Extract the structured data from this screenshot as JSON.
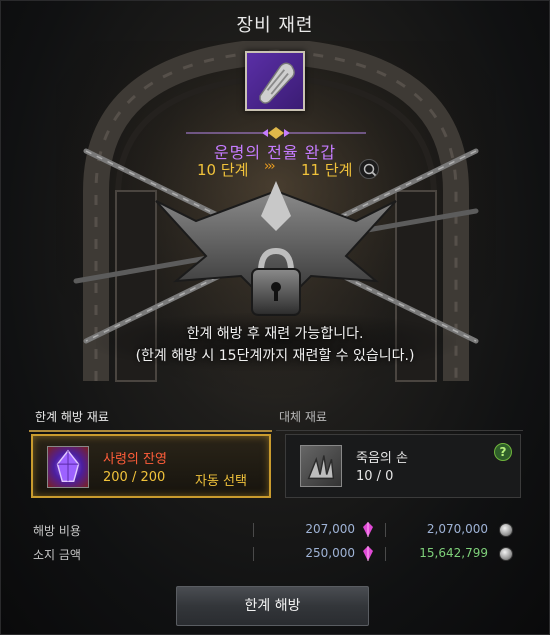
{
  "window": {
    "title": "장비 재련"
  },
  "item": {
    "icon": "gauntlet-icon",
    "name": "운명의 전율 완갑",
    "grade_from": "10 단계",
    "grade_arrows": "›››",
    "grade_to": "11 단계",
    "magnify_icon": "magnify-icon"
  },
  "notice": {
    "line1": "한계 해방 후 재련 가능합니다.",
    "line2": "(한계 해방 시 15단계까지 재련할 수 있습니다.)"
  },
  "materials": {
    "left_label": "한계 해방 재료",
    "right_label": "대체 재료",
    "primary": {
      "icon": "spirit-crystal-icon",
      "name": "사령의 잔영",
      "count": "200 / 200",
      "auto_select": "자동 선택"
    },
    "alternate": {
      "icon": "death-claw-icon",
      "name": "죽음의 손",
      "count": "10 / 0",
      "help": "?"
    }
  },
  "costs": {
    "release_cost": {
      "label": "해방 비용",
      "gem_value": "207,000",
      "gold_value": "2,070,000"
    },
    "owned": {
      "label": "소지 금액",
      "gem_value": "250,000",
      "gold_value": "15,642,799"
    }
  },
  "action": {
    "label": "한계 해방"
  },
  "colors": {
    "item_name": "#c57cff",
    "grade": "#f0c23b",
    "primary_material_name": "#ff5d3a",
    "gold_owned": "#7ed07a",
    "highlight_border": "#c99b2e"
  }
}
